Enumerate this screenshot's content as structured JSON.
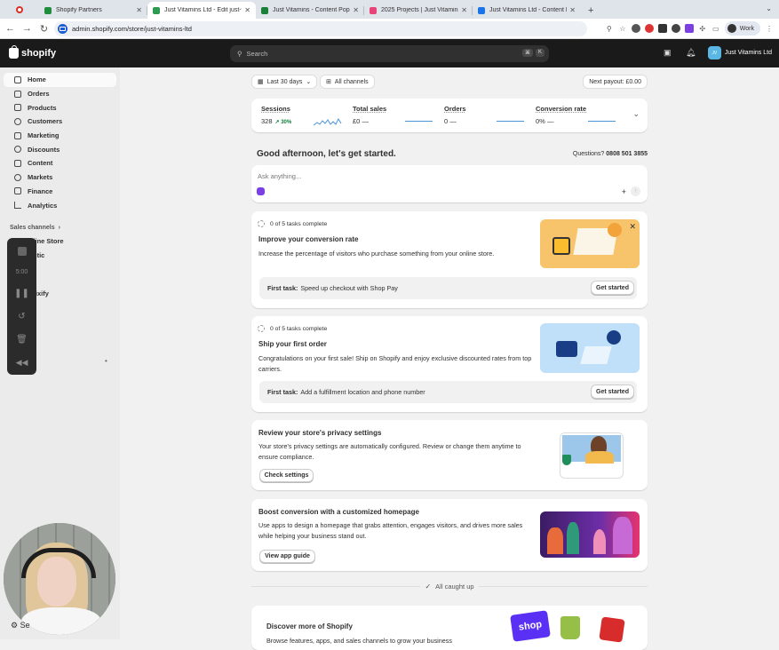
{
  "browser": {
    "tabs": [
      {
        "title": "Shopify Partners",
        "color": "#1e8e3e",
        "active": false
      },
      {
        "title": "Just Vitamins Ltd - Edit just-vitam",
        "color": "#2e9a52",
        "active": true
      },
      {
        "title": "Just Vitamins - Content Popu",
        "color": "#188038",
        "active": false
      },
      {
        "title": "2025 Projects | Just Vitamins",
        "color": "#e8447a",
        "active": false
      },
      {
        "title": "Just Vitamins Ltd - Content P",
        "color": "#1a73e8",
        "active": false
      }
    ],
    "new_tab": "+",
    "url": "admin.shopify.com/store/just-vitamins-ltd",
    "profile": "Work"
  },
  "topbar": {
    "logo_text": "shopify",
    "search_placeholder": "Search",
    "shortcut_keys": [
      "⌘",
      "K"
    ],
    "store_initials": "JV",
    "store_name": "Just Vitamins Ltd"
  },
  "sidebar": {
    "items": [
      {
        "label": "Home",
        "active": true
      },
      {
        "label": "Orders"
      },
      {
        "label": "Products"
      },
      {
        "label": "Customers"
      },
      {
        "label": "Marketing"
      },
      {
        "label": "Discounts"
      },
      {
        "label": "Content"
      },
      {
        "label": "Markets"
      },
      {
        "label": "Finance"
      },
      {
        "label": "Analytics"
      }
    ],
    "channels_label": "Sales channels",
    "channels": [
      "Online Store",
      "ntic",
      "rixify"
    ],
    "settings_label": "Se"
  },
  "recorder": {
    "timer": "5:00"
  },
  "filters": {
    "date": "Last 30 days",
    "channels": "All channels",
    "payout": "Next payout: £0.00"
  },
  "metrics": [
    {
      "label": "Sessions",
      "value": "328",
      "change": "30%"
    },
    {
      "label": "Total sales",
      "value": "£0",
      "change": "—"
    },
    {
      "label": "Orders",
      "value": "0",
      "change": "—"
    },
    {
      "label": "Conversion rate",
      "value": "0%",
      "change": "—"
    }
  ],
  "greeting": "Good afternoon, let's get started.",
  "questions": {
    "label": "Questions?",
    "phone": "0808 501 3855"
  },
  "ask_placeholder": "Ask anything...",
  "tasks": [
    {
      "progress": "0 of 5 tasks complete",
      "title": "Improve your conversion rate",
      "description": "Increase the percentage of visitors who purchase something from your online store.",
      "first_task_label": "First task:",
      "first_task": "Speed up checkout with Shop Pay",
      "button": "Get started"
    },
    {
      "progress": "0 of 5 tasks complete",
      "title": "Ship your first order",
      "description": "Congratulations on your first sale! Ship on Shopify and enjoy exclusive discounted rates from top carriers.",
      "first_task_label": "First task:",
      "first_task": "Add a fulfillment location and phone number",
      "button": "Get started"
    }
  ],
  "privacy": {
    "title": "Review your store's privacy settings",
    "description": "Your store's privacy settings are automatically configured. Review or change them anytime to ensure compliance.",
    "button": "Check settings"
  },
  "boost": {
    "title": "Boost conversion with a customized homepage",
    "description": "Use apps to design a homepage that grabs attention, engages visitors, and drives more sales while helping your business stand out.",
    "button": "View app guide"
  },
  "caught_up": "All caught up",
  "discover": {
    "title": "Discover more of Shopify",
    "subtitle": "Browse features, apps, and sales channels to grow your business",
    "shop_logo": "shop"
  }
}
